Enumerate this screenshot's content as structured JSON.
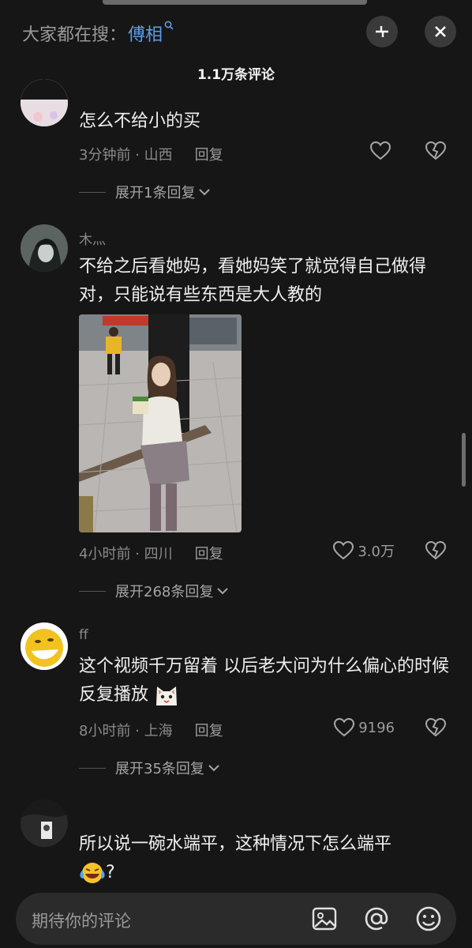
{
  "header": {
    "search_prefix": "大家都在搜：",
    "search_term": "傅相",
    "comment_count": "1.1万条评论"
  },
  "comments": [
    {
      "text": "怎么不给小的买",
      "meta": "3分钟前 · 山西",
      "reply_label": "回复",
      "expand_label": "展开1条回复"
    },
    {
      "username": "木灬",
      "text": "不给之后看她妈，看她妈笑了就觉得自己做得对，只能说有些东西是大人教的",
      "meta": "4小时前 · 四川",
      "reply_label": "回复",
      "likes": "3.0万",
      "expand_label": "展开268条回复"
    },
    {
      "username": "ff",
      "text": "这个视频千万留着 以后老大问为什么偏心的时候反复播放",
      "meta": "8小时前 · 上海",
      "reply_label": "回复",
      "likes": "9196",
      "expand_label": "展开35条回复"
    },
    {
      "text": "所以说一碗水端平，这种情况下怎么端平",
      "text_suffix": "?"
    }
  ],
  "input": {
    "placeholder": "期待你的评论"
  },
  "icons": {
    "collapse": "collapse-icon",
    "close": "close-icon",
    "like": "heart-icon",
    "dislike": "broken-heart-icon",
    "image": "image-icon",
    "mention": "at-icon",
    "emoji": "emoji-icon"
  },
  "colors": {
    "accent": "#5f9ce8",
    "background": "#161616"
  }
}
